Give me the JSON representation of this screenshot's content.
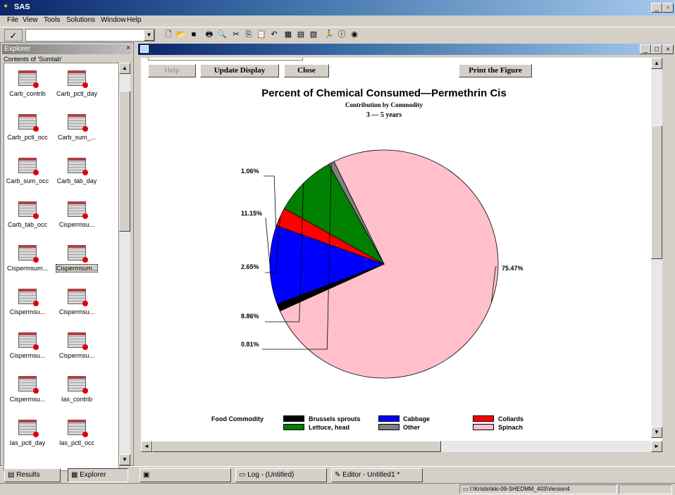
{
  "app": {
    "title": "SAS"
  },
  "menu": [
    "File",
    "View",
    "Tools",
    "Solutions",
    "Window",
    "Help"
  ],
  "toolbar": {
    "command_value": ""
  },
  "explorer": {
    "title": "Explorer",
    "contents_label": "Contents of 'Sumtab'",
    "items": [
      "Carb_contrib",
      "Carb_pctl_day",
      "Carb_pctl_occ",
      "Carb_sum_...",
      "Carb_sum_occ",
      "Carb_tab_day",
      "Carb_tab_occ",
      "Cispermsu...",
      "Cispermsum...",
      "Cispermsum...",
      "Cispermsu...",
      "Cispermsu...",
      "Cispermsu...",
      "Cispermsu...",
      "Cispermsu...",
      "Ias_contrib",
      "Ias_pctl_day",
      "Ias_pctl_occ"
    ]
  },
  "buttons": {
    "help": "Help",
    "update": "Update Display",
    "close": "Close",
    "print": "Print the Figure"
  },
  "chart_data": {
    "type": "pie",
    "title": "Percent of Chemical Consumed—Permethrin Cis",
    "subtitle": "Contribution by Commodity",
    "subtitle2": "3 — 5 years",
    "legend_title": "Food Commodity",
    "slices": [
      {
        "name": "Spinach",
        "value": 75.47,
        "label": "75.47%",
        "color": "#ffc0cb"
      },
      {
        "name": "Brussels sprouts",
        "value": 1.06,
        "label": "1.06%",
        "color": "#000000"
      },
      {
        "name": "Cabbage",
        "value": 11.15,
        "label": "11.15%",
        "color": "#0000ff"
      },
      {
        "name": "Collards",
        "value": 2.65,
        "label": "2.65%",
        "color": "#ff0000"
      },
      {
        "name": "Lettuce, head",
        "value": 8.86,
        "label": "8.86%",
        "color": "#008000"
      },
      {
        "name": "Other",
        "value": 0.81,
        "label": "0.81%",
        "color": "#808080"
      }
    ],
    "legend": [
      "Brussels sprouts",
      "Cabbage",
      "Collards",
      "Lettuce, head",
      "Other",
      "Spinach"
    ]
  },
  "taskbar": {
    "results": "Results",
    "explorer": "Explorer",
    "log": "Log - (Untitled)",
    "editor": "Editor - Untitled1 *"
  },
  "status": {
    "path": "I:\\Kristin\\kki-09-SHEDMM_403\\Version4"
  }
}
